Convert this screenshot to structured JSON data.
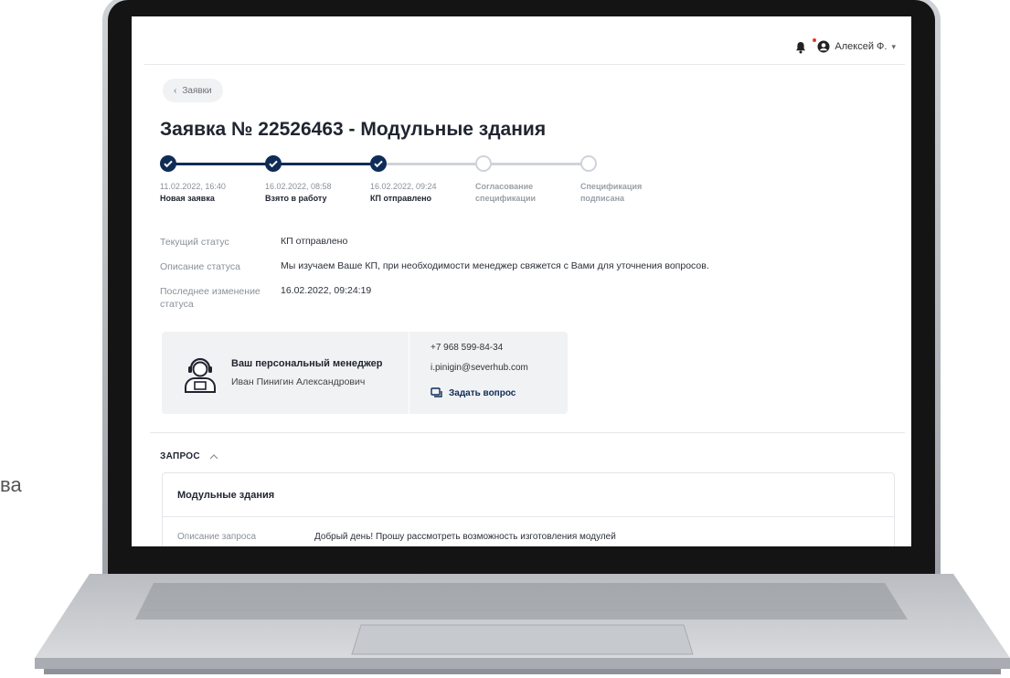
{
  "side_fragment": "ва",
  "header": {
    "user_name": "Алексей Ф.",
    "user_chevron": "▾"
  },
  "back_button": {
    "label": "Заявки",
    "icon": "chevron-left-icon"
  },
  "page_title": "Заявка № 22526463 - Модульные здания",
  "steps": [
    {
      "date": "11.02.2022, 16:40",
      "label": "Новая заявка",
      "done": true
    },
    {
      "date": "16.02.2022, 08:58",
      "label": "Взято в работу",
      "done": true
    },
    {
      "date": "16.02.2022, 09:24",
      "label": "КП отправлено",
      "done": true
    },
    {
      "date": "",
      "label": "Согласование спецификации",
      "done": false
    },
    {
      "date": "",
      "label": "Спецификация подписана",
      "done": false
    }
  ],
  "status": {
    "current_label": "Текущий статус",
    "current_value": "КП отправлено",
    "desc_label": "Описание статуса",
    "desc_value": "Мы изучаем Ваше КП, при необходимости менеджер свяжется с Вами для уточнения вопросов.",
    "changed_label": "Последнее изменение статуса",
    "changed_value": "16.02.2022, 09:24:19"
  },
  "manager": {
    "title": "Ваш персональный менеджер",
    "name": "Иван Пинигин Александрович",
    "phone": "+7 968 599-84-34",
    "email": "i.pinigin@severhub.com",
    "ask_label": "Задать вопрос"
  },
  "request": {
    "section_label": "ЗАПРОС",
    "card_title": "Модульные здания",
    "desc_label": "Описание запроса",
    "desc_value": "Добрый день! Прошу рассмотреть возможность изготовления модулей"
  },
  "colors": {
    "accent": "#0f2c57",
    "notification": "#e5352b",
    "pending": "#cfd3d9"
  }
}
